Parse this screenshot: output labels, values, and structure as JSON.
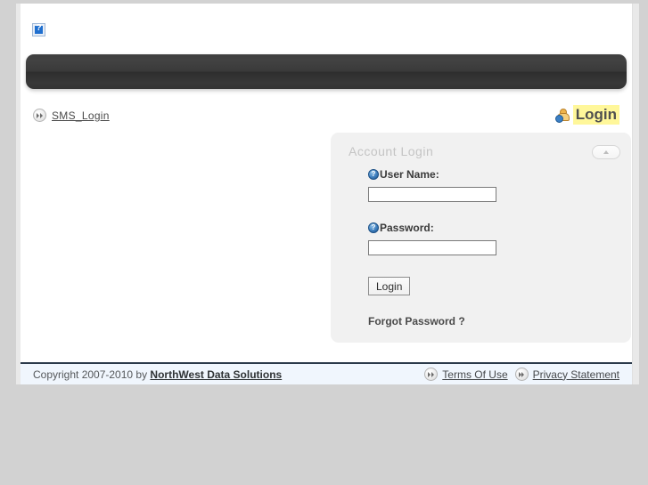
{
  "page": {
    "background_color": "#d2d2d2",
    "content_background": "#ffffff"
  },
  "header": {
    "logo_alt_icon": "broken-image-icon",
    "logo_placeholder_glyph": "?",
    "banner_color": "#383838"
  },
  "breadcrumb": {
    "bullet_icon": "double-chevron-bullet-icon",
    "items": [
      {
        "label": "SMS_Login"
      }
    ]
  },
  "page_title": {
    "icon": "user-login-icon",
    "label": "Login",
    "highlight_color": "#fff79a",
    "text_color": "#4f4f4f"
  },
  "login_panel": {
    "title": "Account Login",
    "collapse_button_icon": "chevron-up-icon",
    "background_color": "#f1f1f1",
    "fields": [
      {
        "id": "username",
        "help_icon": "help-question-icon",
        "label": "User Name:",
        "value": "",
        "placeholder": "",
        "type": "text"
      },
      {
        "id": "password",
        "help_icon": "help-question-icon",
        "label": "Password:",
        "value": "",
        "placeholder": "",
        "type": "password"
      }
    ],
    "submit_label": "Login",
    "forgot_password_label": "Forgot Password ?"
  },
  "footer": {
    "copyright_prefix": "Copyright 2007-2010 by ",
    "company_link": "NorthWest Data Solutions",
    "bullet_icon": "double-chevron-bullet-icon",
    "links": [
      {
        "label": "Terms Of Use"
      },
      {
        "label": "Privacy Statement"
      }
    ]
  }
}
